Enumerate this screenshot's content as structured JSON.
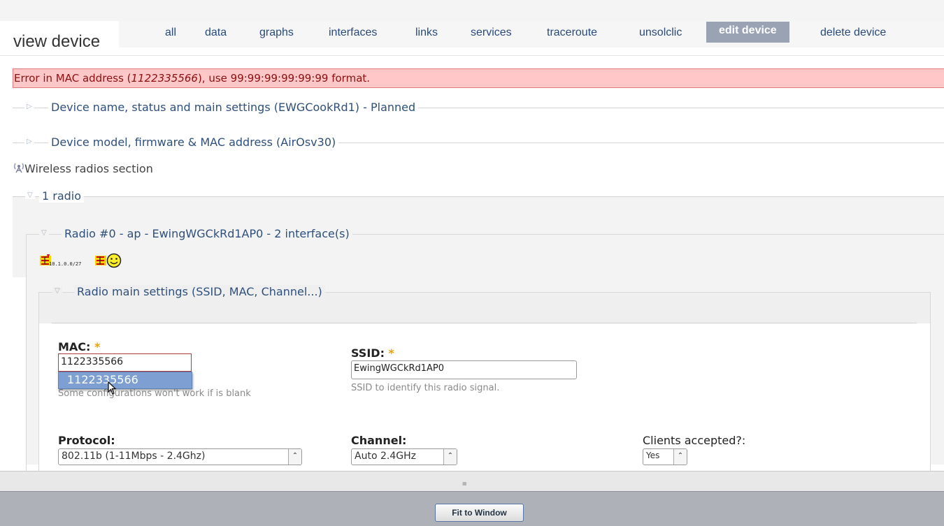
{
  "header": {
    "title": "view device",
    "tabs": [
      {
        "label": "all"
      },
      {
        "label": "data"
      },
      {
        "label": "graphs"
      },
      {
        "label": "interfaces"
      },
      {
        "label": "links"
      },
      {
        "label": "services"
      },
      {
        "label": "traceroute"
      },
      {
        "label": "unsolclic"
      },
      {
        "label": "edit device",
        "active": true
      },
      {
        "label": "delete device"
      }
    ]
  },
  "error": {
    "prefix": "Error in MAC address (",
    "value": "1122335566",
    "suffix": "), use 99:99:99:99:99:99 format."
  },
  "sections": {
    "device_name": "Device name, status and main settings (EWGCookRd1) - Planned",
    "device_model": "Device model, firmware & MAC address (AirOsv30)",
    "wireless_radios": "Wireless radios section",
    "radio_count": "1 radio",
    "radio0": "Radio #0 - ap - EwingWGCkRd1AP0 - 2 interface(s)",
    "radio_main_settings": "Radio main settings (SSID, MAC, Channel...)"
  },
  "radio_icons": {
    "ip_text": "10.1.0.0/27"
  },
  "form": {
    "mac": {
      "label": "MAC:",
      "required_mark": "*",
      "value": "1122335566",
      "autocomplete": "1122335566",
      "help": "Some configurations won't work if is blank"
    },
    "ssid": {
      "label": "SSID:",
      "required_mark": "*",
      "value": "EwingWGCkRd1AP0",
      "help": "SSID to identify this radio signal."
    },
    "protocol": {
      "label": "Protocol:",
      "selected": "802.11b (1-11Mbps - 2.4Ghz)"
    },
    "channel": {
      "label": "Channel:",
      "selected": "Auto 2.4GHz"
    },
    "clients": {
      "label": "Clients accepted?:",
      "selected": "Yes"
    }
  },
  "bottom": {
    "grip": "IIIII",
    "fit_button": "Fit to Window"
  },
  "colors": {
    "link": "#2a4a7a",
    "active_tab": "#9aa3b3",
    "error_bg": "#ffc7c7",
    "error_text": "#8b1010",
    "required": "#f0a000",
    "autocomplete_bg": "#7e9fd1"
  }
}
